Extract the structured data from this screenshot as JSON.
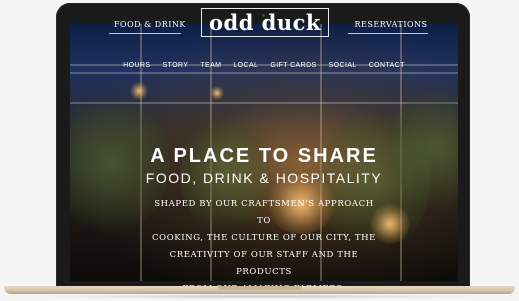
{
  "site": {
    "logo": "odd duck",
    "top_nav": {
      "left": "FOOD & DRINK",
      "right": "RESERVATIONS"
    },
    "main_nav": [
      "HOURS",
      "STORY",
      "TEAM",
      "LOCAL",
      "GIFT CARDS",
      "SOCIAL",
      "CONTACT"
    ],
    "hero": {
      "title": "A PLACE TO SHARE",
      "subtitle": "FOOD, DRINK  & HOSPITALITY",
      "body_lines": [
        "SHAPED BY OUR CRAFTSMEN'S APPROACH TO",
        "COOKING, THE CULTURE OF OUR CITY, THE",
        "CREATIVITY OF OUR STAFF AND THE PRODUCTS",
        "FROM OUR AMAZING FARMERS."
      ]
    }
  },
  "colors": {
    "laptop_bezel": "#1a1a1a",
    "laptop_base": "#d6c1a6",
    "text": "#ffffff",
    "sky": "#1f3160"
  }
}
